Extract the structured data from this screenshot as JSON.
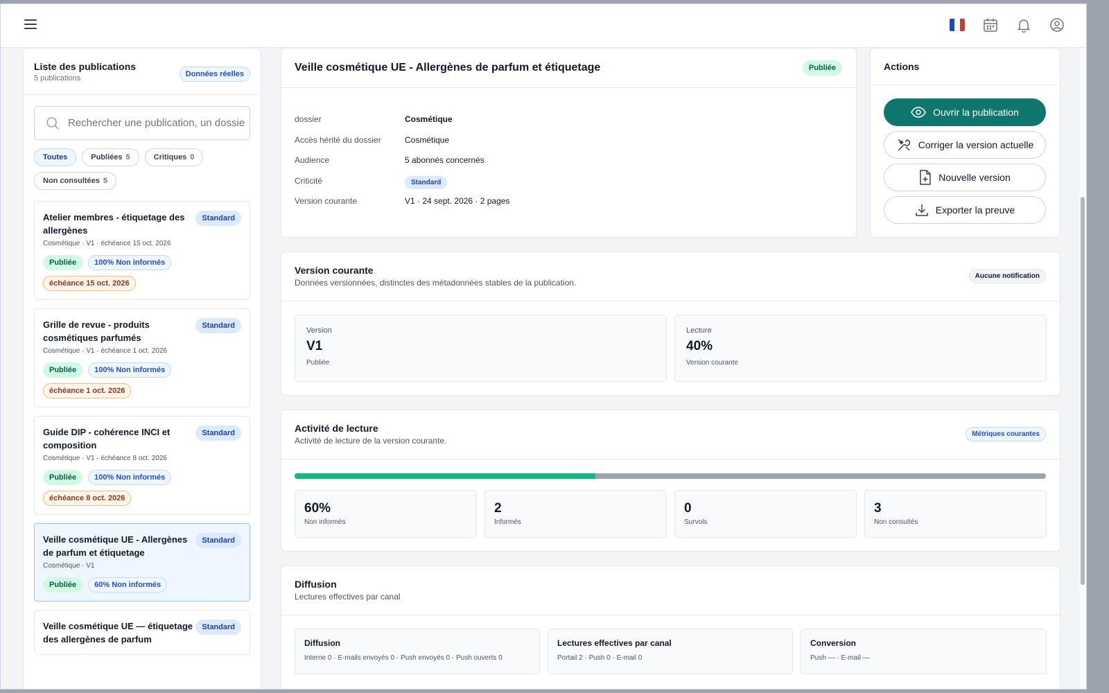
{
  "topbar": {
    "flag_colors": [
      "#1f4ea8",
      "#ffffff",
      "#d03a2e"
    ]
  },
  "sidebar": {
    "title": "Liste des publications",
    "subtitle": "5 publications",
    "badge": "Données réelles",
    "search_placeholder": "Rechercher une publication, un dossier",
    "filters": [
      {
        "label": "Toutes",
        "count": "",
        "active": true
      },
      {
        "label": "Publiées",
        "count": "5",
        "active": false
      },
      {
        "label": "Critiques",
        "count": "0",
        "active": false
      },
      {
        "label": "Non consultées",
        "count": "5",
        "active": false
      }
    ],
    "publications": [
      {
        "title": "Atelier membres - étiquetage des allergènes",
        "level": "Standard",
        "meta": "Cosmétique · V1 · échéance 15 oct. 2026",
        "status": "Publiée",
        "informed": "100% Non informés",
        "deadline": "échéance 15 oct. 2026"
      },
      {
        "title": "Grille de revue - produits cosmétiques parfumés",
        "level": "Standard",
        "meta": "Cosmétique · V1 · échéance 1 oct. 2026",
        "status": "Publiée",
        "informed": "100% Non informés",
        "deadline": "échéance 1 oct. 2026"
      },
      {
        "title": "Guide DIP - cohérence INCI et composition",
        "level": "Standard",
        "meta": "Cosmétique · V1 · échéance 8 oct. 2026",
        "status": "Publiée",
        "informed": "100% Non informés",
        "deadline": "échéance 8 oct. 2026"
      },
      {
        "title": "Veille cosmétique UE - Allergènes de parfum et étiquetage",
        "level": "Standard",
        "meta": "Cosmétique · V1",
        "status": "Publiée",
        "informed": "60% Non informés",
        "deadline": ""
      },
      {
        "title": "Veille cosmétique UE — étiquetage des allergènes de parfum",
        "level": "Standard",
        "meta": "",
        "status": "",
        "informed": "",
        "deadline": ""
      }
    ]
  },
  "publication": {
    "title": "Veille cosmétique UE - Allergènes de parfum et étiquetage",
    "status": "Publiée",
    "meta": [
      {
        "key": "dossier",
        "value": "Cosmétique"
      },
      {
        "key": "Accès hérité du dossier",
        "value": "Cosmétique"
      },
      {
        "key": "Audience",
        "value": "5 abonnés concernés"
      },
      {
        "key": "Criticité",
        "value": "Standard"
      },
      {
        "key": "Version courante",
        "value": "V1 · 24 sept. 2026 · 2 pages"
      }
    ]
  },
  "actions": {
    "title": "Actions",
    "buttons": [
      {
        "label": "Ouvrir la publication",
        "icon": "eye-icon"
      },
      {
        "label": "Corriger la version actuelle",
        "icon": "tools-icon"
      },
      {
        "label": "Nouvelle version",
        "icon": "file-plus-icon"
      },
      {
        "label": "Exporter la preuve",
        "icon": "download-icon"
      }
    ]
  },
  "version_section": {
    "title": "Version courante",
    "subtitle": "Données versionnées, distinctes des métadonnées stables de la publication.",
    "badge": "Aucune notification",
    "version": {
      "label": "Version",
      "value": "V1",
      "sub": "Publiée"
    },
    "reading": {
      "label": "Lecture",
      "value": "40%",
      "sub": "Version courante"
    }
  },
  "activity_section": {
    "title": "Activité de lecture",
    "subtitle": "Activité de lecture de la version courante.",
    "badge": "Métriques courantes",
    "progress_fraction": 0.4,
    "stats": [
      {
        "value": "60%",
        "label": "Non informés"
      },
      {
        "value": "2",
        "label": "Informés"
      },
      {
        "value": "0",
        "label": "Survols"
      },
      {
        "value": "3",
        "label": "Non consultés"
      }
    ]
  },
  "diffusion_section": {
    "title": "Diffusion",
    "subtitle": "Lectures effectives par canal",
    "boxes": [
      {
        "title": "Diffusion",
        "text": "Interne 0 · E-mails envoyés 0 · Push envoyés 0 · Push ouverts 0"
      },
      {
        "title": "Lectures effectives par canal",
        "text": "Portail 2 · Push 0 · E-mail 0"
      },
      {
        "title": "Conversion",
        "text": "Push — · E-mail —"
      }
    ]
  }
}
